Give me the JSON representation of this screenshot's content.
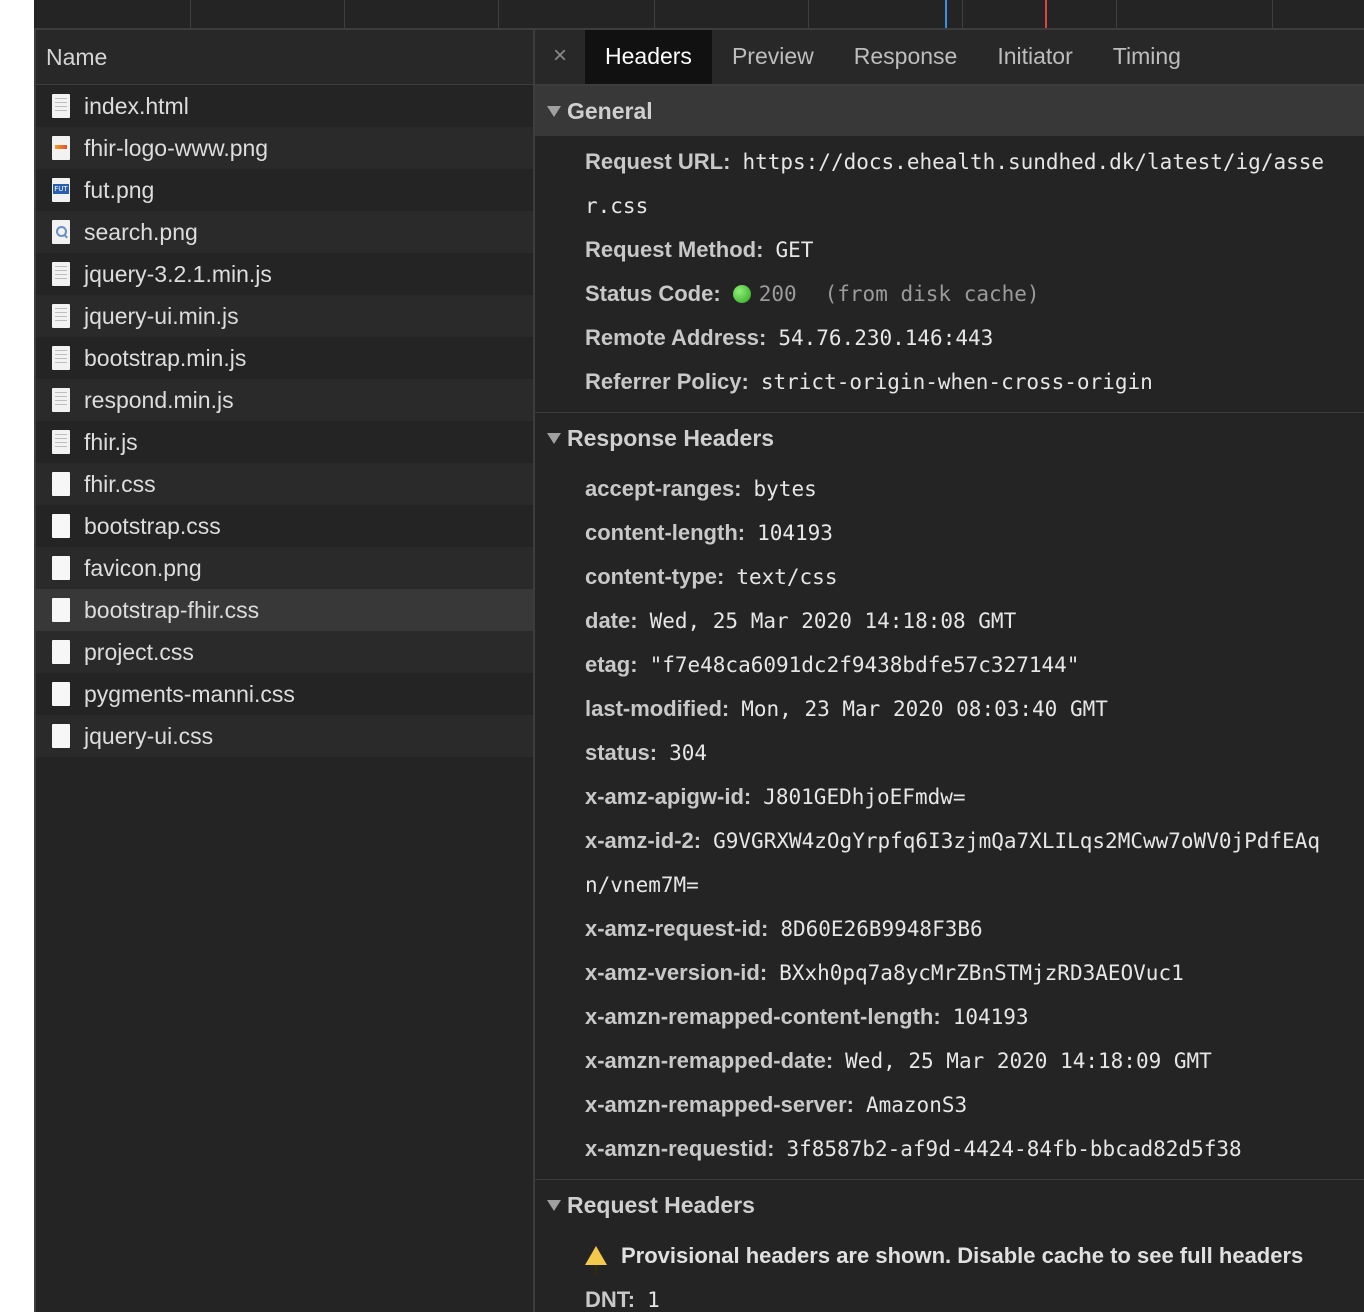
{
  "list": {
    "header": "Name",
    "items": [
      {
        "name": "index.html",
        "icon": "document-icon"
      },
      {
        "name": "fhir-logo-www.png",
        "icon": "image-icon"
      },
      {
        "name": "fut.png",
        "icon": "fut-image-icon"
      },
      {
        "name": "search.png",
        "icon": "search-image-icon"
      },
      {
        "name": "jquery-3.2.1.min.js",
        "icon": "document-icon"
      },
      {
        "name": "jquery-ui.min.js",
        "icon": "document-icon"
      },
      {
        "name": "bootstrap.min.js",
        "icon": "document-icon"
      },
      {
        "name": "respond.min.js",
        "icon": "document-icon"
      },
      {
        "name": "fhir.js",
        "icon": "document-icon"
      },
      {
        "name": "fhir.css",
        "icon": "file-icon"
      },
      {
        "name": "bootstrap.css",
        "icon": "file-icon"
      },
      {
        "name": "favicon.png",
        "icon": "file-icon"
      },
      {
        "name": "bootstrap-fhir.css",
        "icon": "file-icon"
      },
      {
        "name": "project.css",
        "icon": "file-icon"
      },
      {
        "name": "pygments-manni.css",
        "icon": "file-icon"
      },
      {
        "name": "jquery-ui.css",
        "icon": "file-icon"
      }
    ],
    "selected_index": 12
  },
  "tabs": {
    "close": "×",
    "items": [
      "Headers",
      "Preview",
      "Response",
      "Initiator",
      "Timing"
    ],
    "active_index": 0
  },
  "general": {
    "title": "General",
    "request_url_key": "Request URL:",
    "request_url_line1": "https://docs.ehealth.sundhed.dk/latest/ig/asse",
    "request_url_line2": "r.css",
    "method_key": "Request Method:",
    "method": "GET",
    "status_key": "Status Code:",
    "status": "200",
    "status_note": "(from disk cache)",
    "remote_key": "Remote Address:",
    "remote": "54.76.230.146:443",
    "referrer_key": "Referrer Policy:",
    "referrer": "strict-origin-when-cross-origin"
  },
  "response_headers": {
    "title": "Response Headers",
    "items": [
      {
        "k": "accept-ranges:",
        "v": "bytes"
      },
      {
        "k": "content-length:",
        "v": "104193"
      },
      {
        "k": "content-type:",
        "v": "text/css"
      },
      {
        "k": "date:",
        "v": "Wed, 25 Mar 2020 14:18:08 GMT"
      },
      {
        "k": "etag:",
        "v": "\"f7e48ca6091dc2f9438bdfe57c327144\""
      },
      {
        "k": "last-modified:",
        "v": "Mon, 23 Mar 2020 08:03:40 GMT"
      },
      {
        "k": "status:",
        "v": "304"
      },
      {
        "k": "x-amz-apigw-id:",
        "v": "J801GEDhjoEFmdw="
      },
      {
        "k": "x-amz-id-2:",
        "v": "G9VGRXW4zOgYrpfq6I3zjmQa7XLILqs2MCww7oWV0jPdfEAq"
      },
      {
        "k": "",
        "v": "n/vnem7M="
      },
      {
        "k": "x-amz-request-id:",
        "v": "8D60E26B9948F3B6"
      },
      {
        "k": "x-amz-version-id:",
        "v": "BXxh0pq7a8ycMrZBnSTMjzRD3AEOVuc1"
      },
      {
        "k": "x-amzn-remapped-content-length:",
        "v": "104193"
      },
      {
        "k": "x-amzn-remapped-date:",
        "v": "Wed, 25 Mar 2020 14:18:09 GMT"
      },
      {
        "k": "x-amzn-remapped-server:",
        "v": "AmazonS3"
      },
      {
        "k": "x-amzn-requestid:",
        "v": "3f8587b2-af9d-4424-84fb-bbcad82d5f38"
      }
    ]
  },
  "request_headers": {
    "title": "Request Headers",
    "warning": "Provisional headers are shown. Disable cache to see full headers",
    "dnt_key": "DNT:",
    "dnt": "1"
  }
}
